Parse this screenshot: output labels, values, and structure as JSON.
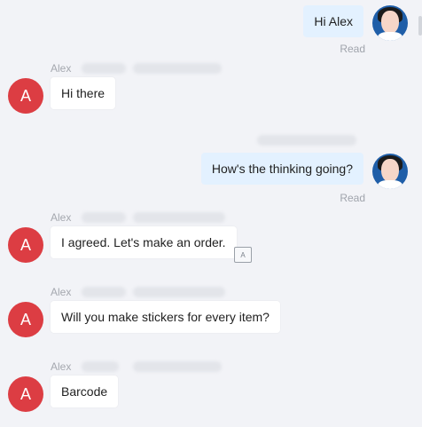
{
  "messages": [
    {
      "side": "right",
      "text": "Hi Alex",
      "status": "Read"
    },
    {
      "side": "left",
      "sender": "Alex",
      "avatar_letter": "A",
      "text": "Hi there"
    },
    {
      "side": "right",
      "text": "How's the thinking going?",
      "status": "Read"
    },
    {
      "side": "left",
      "sender": "Alex",
      "avatar_letter": "A",
      "text": "I agreed. Let's make an order.",
      "action_icon": "translate-icon"
    },
    {
      "side": "left",
      "sender": "Alex",
      "avatar_letter": "A",
      "text": "Will you make stickers for every item?"
    },
    {
      "side": "left",
      "sender": "Alex",
      "avatar_letter": "A",
      "text": "Barcode"
    }
  ],
  "colors": {
    "background": "#f2f3f7",
    "bubble_self": "#e3f1ff",
    "bubble_other": "#ffffff",
    "avatar_other": "#dc3d43",
    "avatar_self": "#1f5ea8"
  }
}
